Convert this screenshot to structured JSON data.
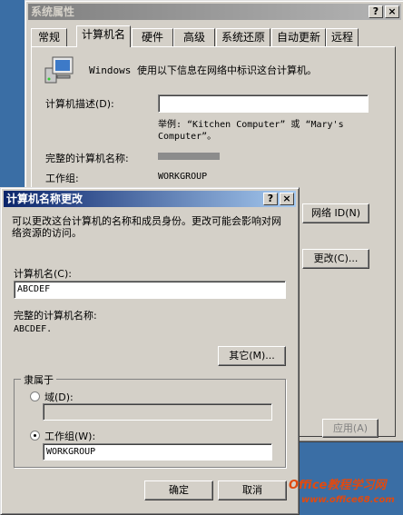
{
  "props": {
    "title": "系统属性",
    "tabs": [
      "常规",
      "计算机名",
      "硬件",
      "高级",
      "系统还原",
      "自动更新",
      "远程"
    ],
    "intro": "Windows 使用以下信息在网络中标识这台计算机。",
    "desc_label": "计算机描述(D):",
    "desc_value": "",
    "example": "举例: “Kitchen Computer” 或 “Mary's Computer”。",
    "fullname_label": "完整的计算机名称:",
    "workgroup_label": "工作组:",
    "workgroup_value": "WORKGROUP",
    "network_id_button": "网络 ID(N)",
    "change_button": "更改(C)...",
    "apply_button": "应用(A)"
  },
  "dialog": {
    "title": "计算机名称更改",
    "intro": "可以更改这台计算机的名称和成员身份。更改可能会影响对网络资源的访问。",
    "name_label": "计算机名(C):",
    "name_value": "ABCDEF",
    "fullname_label": "完整的计算机名称:",
    "fullname_value": "ABCDEF.",
    "other_button": "其它(M)...",
    "member_group": "隶属于",
    "domain_label": "域(D):",
    "domain_value": "",
    "workgroup_label": "工作组(W):",
    "workgroup_value": "WORKGROUP",
    "ok_button": "确定",
    "cancel_button": "取消"
  },
  "titlebar_buttons": {
    "help": "?",
    "close": "×"
  },
  "watermark": {
    "line1": "Office教程学习网",
    "line2": "www.office68.com"
  },
  "colors": {
    "desktop": "#3a6ea5",
    "active_title": "#0a246a",
    "face": "#d4d0c8",
    "watermark": "#e04a10"
  }
}
